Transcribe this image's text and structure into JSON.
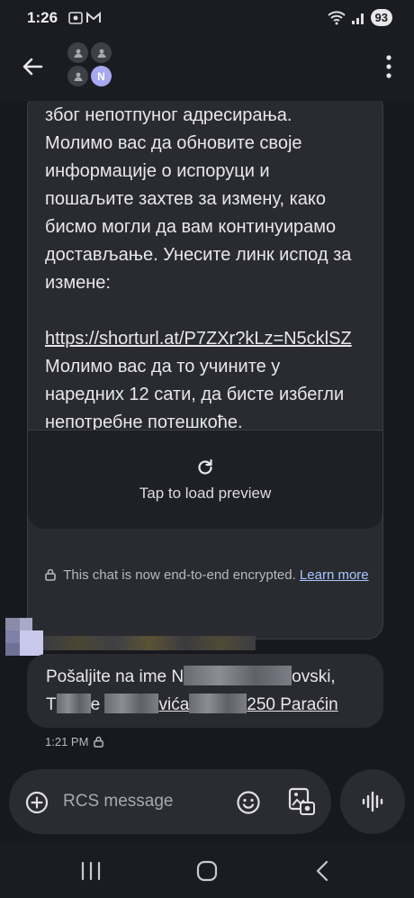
{
  "status_bar": {
    "time": "1:26",
    "battery": "93"
  },
  "app_bar": {
    "avatar_initial": "N"
  },
  "incoming_message": {
    "lines": [
      "због непотпуног адресирања.",
      "Молимо вас да обновите своје",
      "информације о испоруци и",
      "пошаљите захтев за измену, како",
      "бисмо могли да вам континуирамо",
      "достављање. Унесите линк испод за",
      "измене:"
    ],
    "link": "https://shorturl.at/P7ZXr?kLz=N5cklSZ",
    "after_lines": [
      "Молимо вас да то учините у",
      "наредних 12 сати, да бисте избегли",
      "непотребне потешкоће."
    ],
    "preview_label": "Tap to load preview"
  },
  "encryption_notice": {
    "text": "This chat is now end-to-end encrypted.",
    "link": "Learn more"
  },
  "outgoing_message": {
    "line1_start": "Pošaljite na ime N",
    "line1_end": "ovski,",
    "line2_start": "T",
    "line2_mid": "e",
    "line2_link": "vića",
    "line2_end": "250 Paraćin",
    "timestamp": "1:21 PM"
  },
  "compose": {
    "placeholder": "RCS message"
  },
  "colors": {
    "background": "#18191f",
    "bubble": "#2a2b31",
    "link_accent": "#a8c8ff",
    "avatar_accent": "#a6a8f0"
  },
  "icons": [
    "back-arrow-icon",
    "more-vert-icon",
    "refresh-icon",
    "lock-icon",
    "add-circle-icon",
    "emoji-icon",
    "gallery-icon",
    "voice-icon",
    "nav-recents-icon",
    "nav-home-icon",
    "nav-back-icon"
  ]
}
